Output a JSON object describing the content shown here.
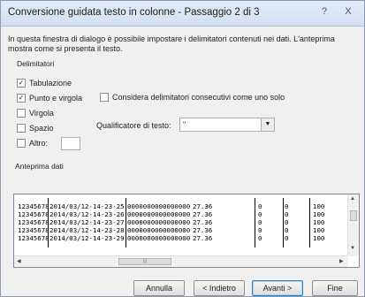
{
  "window": {
    "title": "Conversione guidata testo in colonne - Passaggio 2 di 3",
    "help_glyph": "?",
    "close_glyph": "X"
  },
  "description": "In questa finestra di dialogo è possibile impostare i delimitatori contenuti nei dati. L'anteprima mostra come si presenta il testo.",
  "delimiters": {
    "label": "Delimitatori",
    "items": [
      {
        "label": "Tabulazione",
        "checked": true
      },
      {
        "label": "Punto e virgola",
        "checked": true
      },
      {
        "label": "Virgola",
        "checked": false
      },
      {
        "label": "Spazio",
        "checked": false
      },
      {
        "label": "Altro:",
        "checked": false
      }
    ],
    "other_value": ""
  },
  "consecutive": {
    "label": "Considera delimitatori consecutivi come uno solo",
    "checked": false
  },
  "qualifier": {
    "label": "Qualificatore di testo:",
    "value": "\""
  },
  "preview": {
    "label": "Anteprima dati",
    "rows": [
      [
        "12345678",
        "2014/03/12-14-23-25",
        "0000000000000000",
        "27.36",
        "0",
        "0",
        "100"
      ],
      [
        "12345678",
        "2014/03/12-14-23-26",
        "0000000000000000",
        "27.36",
        "0",
        "0",
        "100"
      ],
      [
        "12345678",
        "2014/03/12-14-23-27",
        "0000000000000000",
        "27.36",
        "0",
        "0",
        "100"
      ],
      [
        "12345678",
        "2014/03/12-14-23-28",
        "0000000000000000",
        "27.36",
        "0",
        "0",
        "100"
      ],
      [
        "12345678",
        "2014/03/12-14-23-29",
        "0000000000000000",
        "27.36",
        "0",
        "0",
        "100"
      ]
    ]
  },
  "buttons": {
    "cancel": "Annulla",
    "back": "< Indietro",
    "next": "Avanti >",
    "finish": "Fine"
  }
}
